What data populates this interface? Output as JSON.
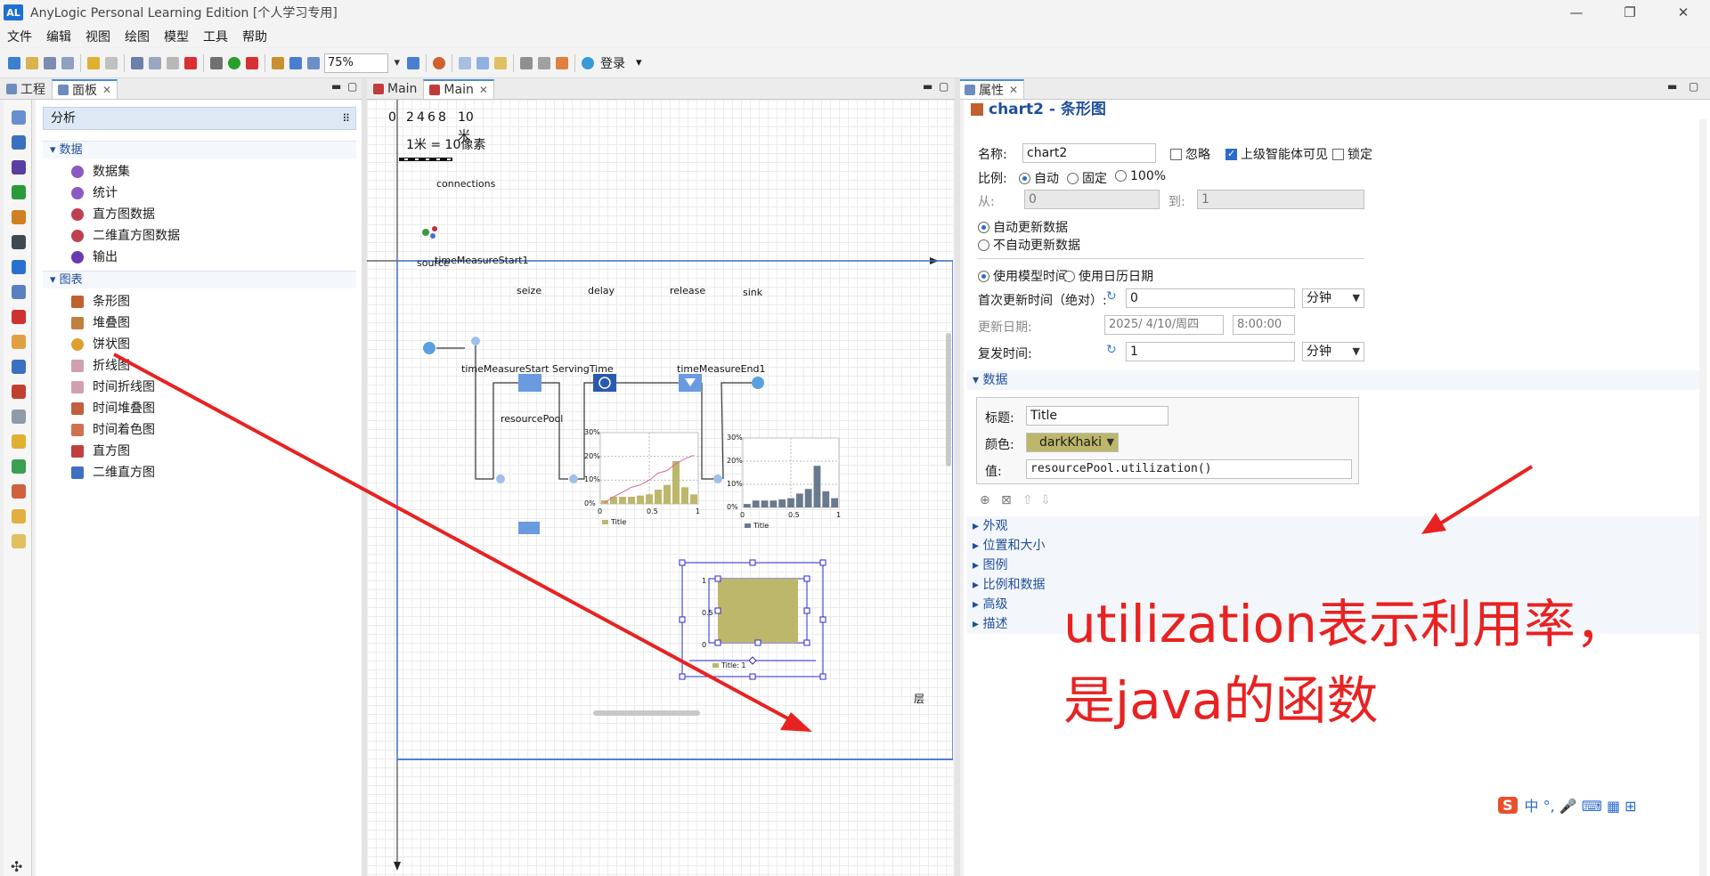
{
  "window": {
    "logo": "AL",
    "title": "AnyLogic Personal Learning Edition [个人学习专用]",
    "min": "—",
    "max": "❐",
    "close": "✕"
  },
  "menu": [
    "文件",
    "编辑",
    "视图",
    "绘图",
    "模型",
    "工具",
    "帮助"
  ],
  "toolbar": {
    "zoom": "75%",
    "login": "登录"
  },
  "left_tabs": {
    "project": "工程",
    "palette": "面板"
  },
  "palette": {
    "header": "分析",
    "sec_data": "数据",
    "data_items": [
      "数据集",
      "统计",
      "直方图数据",
      "二维直方图数据",
      "输出"
    ],
    "sec_charts": "图表",
    "chart_items": [
      "条形图",
      "堆叠图",
      "饼状图",
      "折线图",
      "时间折线图",
      "时间堆叠图",
      "时间着色图",
      "直方图",
      "二维直方图"
    ]
  },
  "editor": {
    "tab1": "Main",
    "tab2": "Main",
    "scale_ticks": [
      "0",
      "2",
      "4",
      "6",
      "8",
      "10"
    ],
    "scale_unit": "米",
    "scale_caption": "1米 = 10像素",
    "connections": "connections",
    "blocks": {
      "source": "source",
      "tms": "timeMeasureStart1",
      "seize": "seize",
      "delay": "delay",
      "release": "release",
      "sink": "sink",
      "tms2": "timeMeasureStart ServingTime",
      "tme": "timeMeasureEnd1",
      "pool": "resourcePool"
    },
    "chart1_ticks": [
      "30%",
      "20%",
      "10%",
      "0%"
    ],
    "chart1_x": [
      "0",
      "0.5",
      "1"
    ],
    "chart2_ticks": [
      "30%",
      "20%",
      "10%",
      "0%"
    ],
    "chart2_x": [
      "0",
      "0.5",
      "1"
    ],
    "chart_legend": "Title",
    "bar_ticks": [
      "1",
      "0.5",
      "0"
    ],
    "bar_legend": "Title: 1",
    "layer_btn": "层"
  },
  "props": {
    "tab": "属性",
    "title": "chart2 - 条形图",
    "name_label": "名称:",
    "name_value": "chart2",
    "ignore": "忽略",
    "visible_upper": "上级智能体可见",
    "lock": "锁定",
    "scale_label": "比例:",
    "scale_auto": "自动",
    "scale_fixed": "固定",
    "scale_100": "100%",
    "from_label": "从:",
    "from_value": "0",
    "to_label": "到:",
    "to_value": "1",
    "auto_update": "自动更新数据",
    "no_auto_update": "不自动更新数据",
    "model_time": "使用模型时间",
    "calendar_date": "使用日历日期",
    "first_update": "首次更新时间（绝对）:",
    "first_update_value": "0",
    "unit1": "分钟",
    "update_date": "更新日期:",
    "date_value": "2025/ 4/10/周四",
    "time_value": "8:00:00",
    "recur": "复发时间:",
    "recur_value": "1",
    "unit2": "分钟",
    "data_section": "数据",
    "series_title_label": "标题:",
    "series_title_value": "Title",
    "color_label": "颜色:",
    "color_value": "darkKhaki",
    "value_label": "值:",
    "value_value": "resourcePool.utilization()",
    "sections": [
      "外观",
      "位置和大小",
      "图例",
      "比例和数据",
      "高级",
      "描述"
    ]
  },
  "annotation": {
    "line1": "utilization表示利用率，",
    "line2": "是java的函数"
  },
  "ime": {
    "logo": "S",
    "text": "中 °, 🎤 ⌨ ▦ ⊞"
  },
  "colors": {
    "accent": "#1f4f9b",
    "darkKhaki": "#bdb76b",
    "arrow": "#e82222"
  },
  "chart_data": [
    {
      "type": "bar",
      "title": "",
      "series": [
        {
          "name": "Title",
          "values": [
            1.5,
            3,
            3,
            3,
            3.5,
            4,
            6,
            8,
            18,
            7,
            4
          ]
        }
      ],
      "trend": [
        0.5,
        3,
        5,
        7,
        8,
        10,
        13,
        14,
        17,
        19,
        20.5
      ],
      "ylim": [
        0,
        30
      ],
      "xlim": [
        0,
        1
      ]
    },
    {
      "type": "bar",
      "title": "",
      "series": [
        {
          "name": "Title",
          "values": [
            1.5,
            3,
            3,
            3,
            3.5,
            4,
            6,
            8,
            18,
            7,
            4
          ]
        }
      ],
      "ylim": [
        0,
        30
      ],
      "xlim": [
        0,
        1
      ]
    },
    {
      "type": "bar",
      "title": "",
      "categories": [
        "Title"
      ],
      "series": [
        {
          "name": "Title",
          "values": [
            1
          ]
        }
      ],
      "ylim": [
        0,
        1
      ]
    }
  ]
}
